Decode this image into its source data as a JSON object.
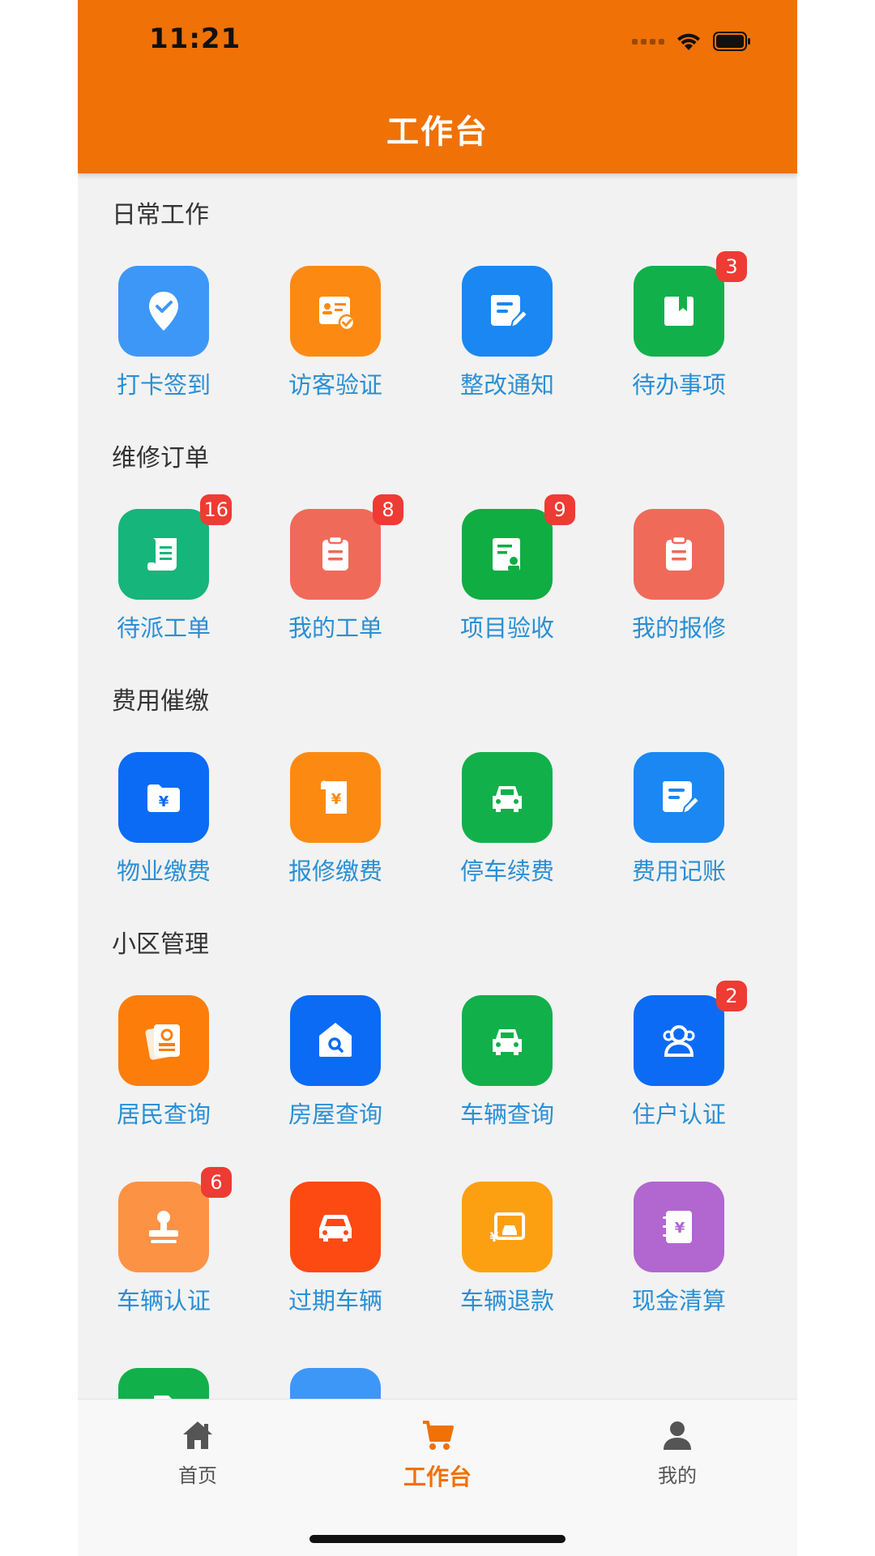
{
  "status_bar": {
    "time": "11:21"
  },
  "header": {
    "title": "工作台"
  },
  "colors": {
    "header_bg": "#f07106",
    "label": "#2a8fd4",
    "badge": "#ee3b33",
    "active_tab": "#f07106"
  },
  "sections": [
    {
      "title": "日常工作",
      "items": [
        {
          "label": "打卡签到",
          "icon": "location-check-icon",
          "color": "#3d97f7",
          "badge": ""
        },
        {
          "label": "访客验证",
          "icon": "id-card-check-icon",
          "color": "#fc8a12",
          "badge": ""
        },
        {
          "label": "整改通知",
          "icon": "edit-document-icon",
          "color": "#1a87f3",
          "badge": ""
        },
        {
          "label": "待办事项",
          "icon": "bookmark-book-icon",
          "color": "#12b04a",
          "badge": "3"
        }
      ]
    },
    {
      "title": "维修订单",
      "items": [
        {
          "label": "待派工单",
          "icon": "scroll-list-icon",
          "color": "#15b57b",
          "badge": "16"
        },
        {
          "label": "我的工单",
          "icon": "clipboard-icon",
          "color": "#f06a5a",
          "badge": "8"
        },
        {
          "label": "项目验收",
          "icon": "inspection-doc-icon",
          "color": "#10ad42",
          "badge": "9"
        },
        {
          "label": "我的报修",
          "icon": "clipboard-icon",
          "color": "#f06a5a",
          "badge": ""
        }
      ]
    },
    {
      "title": "费用催缴",
      "items": [
        {
          "label": "物业缴费",
          "icon": "yen-folder-icon",
          "color": "#0b6bf5",
          "badge": ""
        },
        {
          "label": "报修缴费",
          "icon": "yen-bill-icon",
          "color": "#fc8a12",
          "badge": ""
        },
        {
          "label": "停车续费",
          "icon": "car-front-icon",
          "color": "#12b04a",
          "badge": ""
        },
        {
          "label": "费用记账",
          "icon": "edit-document-icon",
          "color": "#1a87f3",
          "badge": ""
        }
      ]
    },
    {
      "title": "小区管理",
      "items": [
        {
          "label": "居民查询",
          "icon": "resident-card-icon",
          "color": "#fc7d0a",
          "badge": ""
        },
        {
          "label": "房屋查询",
          "icon": "house-search-icon",
          "color": "#0b6bf5",
          "badge": ""
        },
        {
          "label": "车辆查询",
          "icon": "car-front-icon",
          "color": "#12b04a",
          "badge": ""
        },
        {
          "label": "住户认证",
          "icon": "users-icon",
          "color": "#0b6bf5",
          "badge": "2"
        },
        {
          "label": "车辆认证",
          "icon": "stamp-icon",
          "color": "#fc9244",
          "badge": "6"
        },
        {
          "label": "过期车辆",
          "icon": "car-icon",
          "color": "#fc4a12",
          "badge": ""
        },
        {
          "label": "车辆退款",
          "icon": "car-refund-icon",
          "color": "#fca012",
          "badge": ""
        },
        {
          "label": "现金清算",
          "icon": "yen-book-icon",
          "color": "#b266d0",
          "badge": ""
        }
      ]
    }
  ],
  "partial_items": [
    {
      "icon": "document-icon",
      "color": "#12b04a"
    },
    {
      "icon": "chat-icon",
      "color": "#3d97f7"
    }
  ],
  "tabbar": [
    {
      "label": "首页",
      "icon": "home-icon",
      "active": false
    },
    {
      "label": "工作台",
      "icon": "cart-icon",
      "active": true
    },
    {
      "label": "我的",
      "icon": "person-icon",
      "active": false
    }
  ]
}
